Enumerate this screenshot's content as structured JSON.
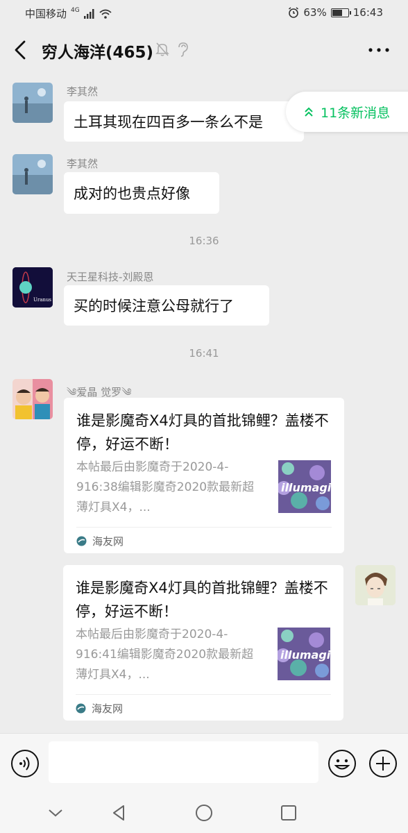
{
  "status_bar": {
    "carrier": "中国移动",
    "network": "4G",
    "battery": "63%",
    "battery_level": 0.63,
    "time": "16:43"
  },
  "header": {
    "back_icon": "chevron-left-icon",
    "title": "穷人海洋(465)",
    "mute_icon": "bell-muted-icon",
    "earpiece_icon": "ear-icon",
    "more_icon": "more-dots-icon"
  },
  "new_messages": {
    "label": "11条新消息",
    "color": "#07c160"
  },
  "messages": [
    {
      "sender": "李其然",
      "text": "土耳其现在四百多一条么不是"
    },
    {
      "sender": "李其然",
      "text": "成对的也贵点好像"
    },
    {
      "time": "16:36"
    },
    {
      "sender": "天王星科技-刘殿恩",
      "text": "买的时候注意公母就行了",
      "avatar_text": "Uranus"
    },
    {
      "time": "16:41"
    },
    {
      "sender": "༄爱晶 觉罗༄",
      "card": {
        "title": "谁是影魔奇X4灯具的首批锦鲤？盖楼不停，好运不断！",
        "desc": "本帖最后由影魔奇于2020-4-916:38编辑影魔奇2020款最新超薄灯具X4，...",
        "thumb_text": "illumagic",
        "source": "海友网"
      }
    },
    {
      "self": true,
      "card": {
        "title": "谁是影魔奇X4灯具的首批锦鲤？盖楼不停，好运不断！",
        "desc": "本帖最后由影魔奇于2020-4-916:41编辑影魔奇2020款最新超薄灯具X4，...",
        "thumb_text": "illumagic",
        "source": "海友网"
      }
    }
  ],
  "input_bar": {
    "voice_icon": "voice-icon",
    "emoji_icon": "emoji-icon",
    "plus_icon": "plus-circle-icon",
    "placeholder": ""
  },
  "nav_bar": {
    "icons": [
      "chevron-down-icon",
      "back-triangle-icon",
      "home-circle-icon",
      "recents-square-icon"
    ]
  }
}
